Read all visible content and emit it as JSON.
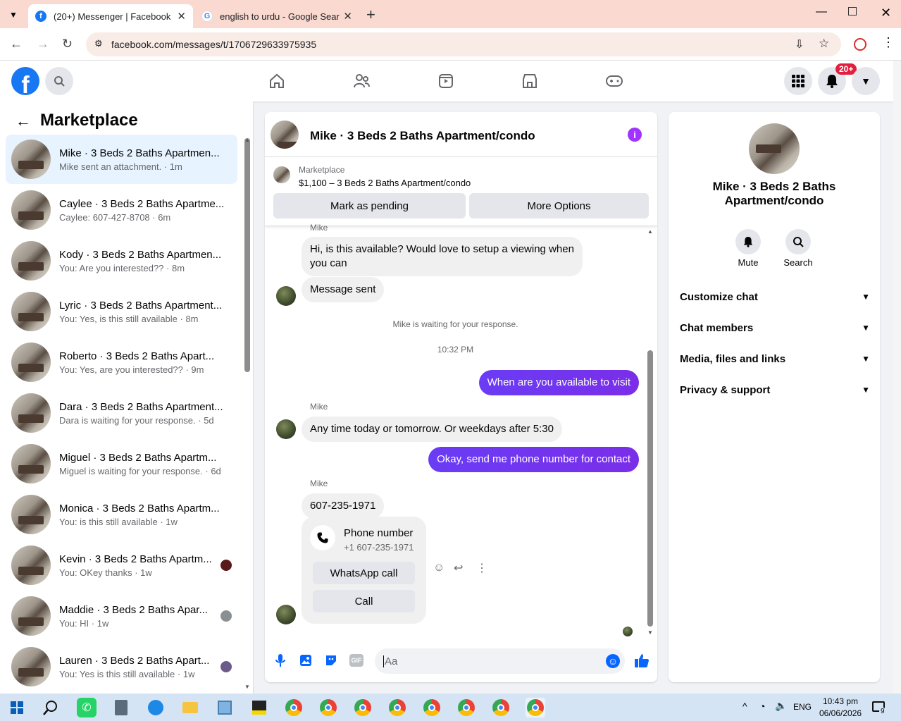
{
  "browser": {
    "tabs": [
      {
        "title": "(20+) Messenger | Facebook",
        "icon": "facebook-icon"
      },
      {
        "title": "english to urdu - Google Search",
        "icon": "google-icon"
      }
    ],
    "url": "facebook.com/messages/t/1706729633975935"
  },
  "fbnav": {
    "notification_badge": "20+"
  },
  "sidebar": {
    "title": "Marketplace",
    "conversations": [
      {
        "title": "Mike · 3 Beds 2 Baths Apartmen...",
        "subtitle": "Mike sent an attachment. · 1m",
        "active": true
      },
      {
        "title": "Caylee · 3 Beds 2 Baths Apartme...",
        "subtitle": "Caylee: 607-427-8708 · 6m"
      },
      {
        "title": "Kody · 3 Beds 2 Baths Apartmen...",
        "subtitle": "You: Are you interested?? · 8m"
      },
      {
        "title": "Lyric · 3 Beds 2 Baths Apartment...",
        "subtitle": "You: Yes, is this still available · 8m"
      },
      {
        "title": "Roberto · 3 Beds 2 Baths Apart...",
        "subtitle": "You: Yes, are you interested?? · 9m"
      },
      {
        "title": "Dara · 3 Beds 2 Baths Apartment...",
        "subtitle": "Dara is waiting for your response. · 5d"
      },
      {
        "title": "Miguel · 3 Beds 2 Baths Apartm...",
        "subtitle": "Miguel is waiting for your response. · 6d"
      },
      {
        "title": "Monica · 3 Beds 2 Baths Apartm...",
        "subtitle": "You: is this still available · 1w"
      },
      {
        "title": "Kevin · 3 Beds 2 Baths Apartm...",
        "subtitle": "You: OKey thanks · 1w",
        "seen_color": "#5a1a1a"
      },
      {
        "title": "Maddie · 3 Beds 2 Baths Apar...",
        "subtitle": "You: HI · 1w",
        "seen_color": "#8a8f94"
      },
      {
        "title": "Lauren · 3 Beds 2 Baths Apart...",
        "subtitle": "You: Yes is this still available · 1w",
        "seen_color": "#6b5a8a"
      }
    ]
  },
  "chat": {
    "title": "Mike · 3 Beds 2 Baths Apartment/condo",
    "listing_label": "Marketplace",
    "listing_detail": "$1,100 – 3 Beds 2 Baths Apartment/condo",
    "mark_pending": "Mark as pending",
    "more_options": "More Options",
    "sender_top": "Mike",
    "msg1": "Hi, is this available? Would love to setup a viewing when you can",
    "msg2": "Message sent",
    "waiting": "Mike is waiting for your response.",
    "time": "10:32 PM",
    "me1": "When are you available to visit",
    "sender2": "Mike",
    "msg3": "Any time today or tomorrow. Or weekdays after 5:30",
    "me2": "Okay, send me phone number for contact",
    "sender3": "Mike",
    "msg4": "607-235-1971",
    "phone_card_title": "Phone number",
    "phone_card_number": "+1 607-235-1971",
    "whatsapp_call": "WhatsApp call",
    "call": "Call",
    "input_placeholder": "Aa",
    "accent": "#7a2ee8"
  },
  "info": {
    "name": "Mike · 3 Beds 2 Baths Apartment/condo",
    "mute": "Mute",
    "search": "Search",
    "rows": [
      "Customize chat",
      "Chat members",
      "Media, files and links",
      "Privacy & support"
    ]
  },
  "taskbar": {
    "lang": "ENG",
    "time": "10:43 pm",
    "date": "06/06/2026",
    "notif_count": "9"
  }
}
